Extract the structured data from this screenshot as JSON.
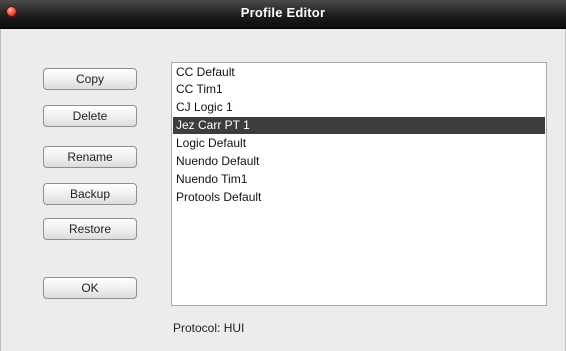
{
  "window": {
    "title": "Profile Editor"
  },
  "buttons": {
    "copy": "Copy",
    "delete": "Delete",
    "rename": "Rename",
    "backup": "Backup",
    "restore": "Restore",
    "ok": "OK"
  },
  "profiles": {
    "items": [
      "CC Default",
      "CC Tim1",
      "CJ Logic 1",
      "Jez Carr PT 1",
      "Logic Default",
      "Nuendo Default",
      "Nuendo Tim1",
      "Protools Default"
    ],
    "selected": "Jez Carr PT 1"
  },
  "footer": {
    "protocol_text": "Protocol:  HUI"
  },
  "colors": {
    "selection": "#3d3d3d",
    "titlebar": "#1e1e1e",
    "close_button": "#e8503d"
  }
}
